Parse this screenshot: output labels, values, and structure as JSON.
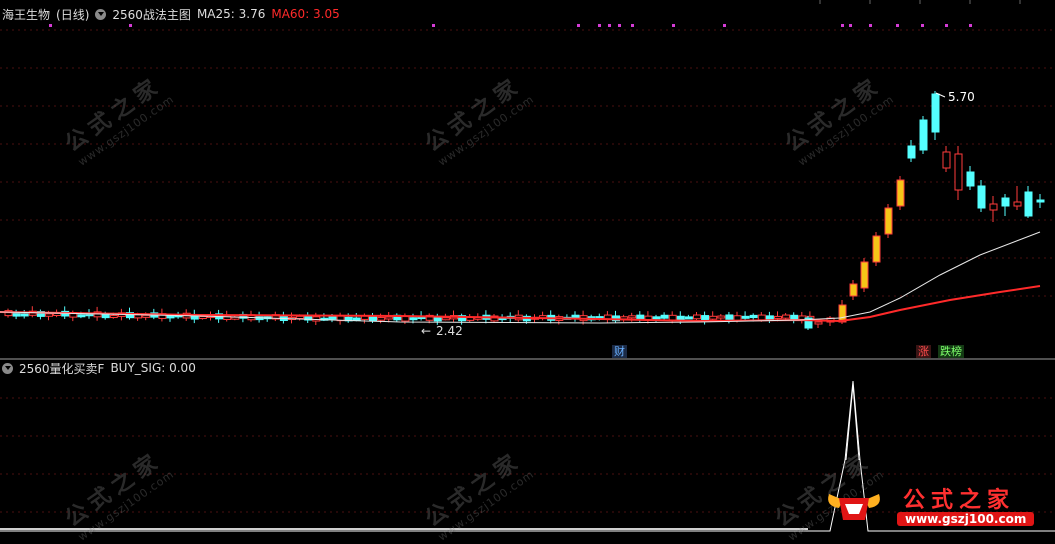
{
  "main_panel": {
    "stock_name": "海王生物",
    "period": "(日线)",
    "indicator": "2560战法主图",
    "ma25_label": "MA25: 3.76",
    "ma60_label": "MA60: 3.05",
    "high_label": "5.70",
    "low_label": "2.42",
    "badge_cai": "财",
    "badge_zhang": "涨",
    "badge_diebang": "跌榜"
  },
  "sub_panel": {
    "indicator": "2560量化买卖F",
    "buy_sig_label": "BUY_SIG: 0.00"
  },
  "watermark": {
    "text": "公式之家",
    "url": "www.gszj100.com"
  },
  "logo": {
    "text": "公式之家",
    "url": "www.gszj100.com"
  },
  "colors": {
    "background": "#000000",
    "ma60": "#ff2a2a",
    "ma25": "#e8e8e8",
    "up_candle": "#ff3b3b",
    "limit_up_candle": "#f5c518",
    "down_candle": "#54ffff",
    "signal_dot": "#d53cd5"
  },
  "chart_data": {
    "type": "candlestick",
    "ma25_last": 3.76,
    "ma60_last": 3.05,
    "annotated_high": 5.7,
    "annotated_low": 2.42,
    "buy_sig_last": 0.0,
    "series": [
      {
        "name": "MA25",
        "value": 3.76
      },
      {
        "name": "MA60",
        "value": 3.05
      },
      {
        "name": "BUY_SIG",
        "value": 0.0
      }
    ]
  }
}
